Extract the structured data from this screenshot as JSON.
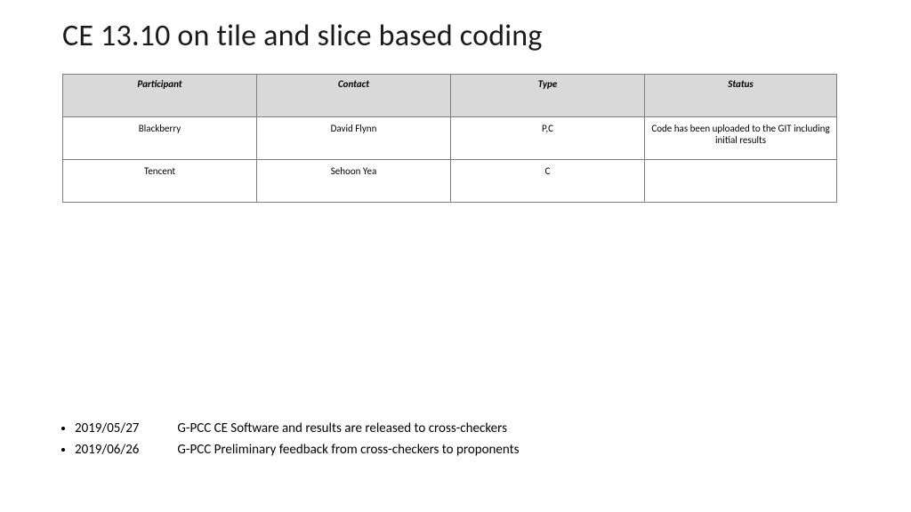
{
  "title": "CE 13.10 on tile and slice based coding",
  "table": {
    "headers": [
      "Participant",
      "Contact",
      "Type",
      "Status"
    ],
    "rows": [
      {
        "participant": "Blackberry",
        "contact": "David Flynn",
        "type": "P,C",
        "status": "Code has been uploaded to the GIT including initial results"
      },
      {
        "participant": "Tencent",
        "contact": "Sehoon Yea",
        "type": "C",
        "status": ""
      }
    ]
  },
  "schedule": [
    {
      "date": "2019/05/27",
      "desc": "G-PCC CE Software and results are released to cross-checkers"
    },
    {
      "date": "2019/06/26",
      "desc": "G-PCC Preliminary feedback from cross-checkers to proponents"
    }
  ]
}
